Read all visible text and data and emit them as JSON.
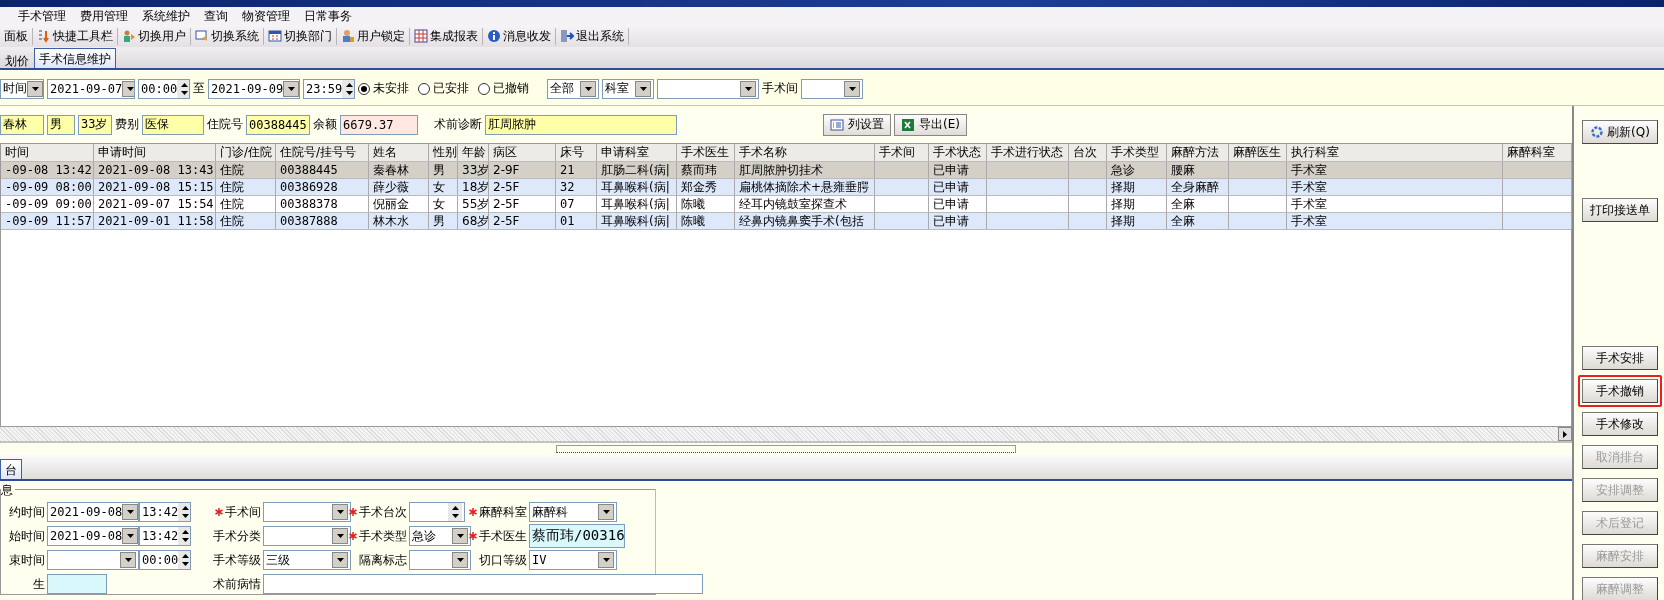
{
  "menu": [
    "手术管理",
    "费用管理",
    "系统维护",
    "查询",
    "物资管理",
    "日常事务"
  ],
  "toolbar": [
    {
      "label": "面板",
      "kind": "none"
    },
    {
      "label": "快捷工具栏",
      "kind": "list"
    },
    {
      "label": "切换用户",
      "kind": "users"
    },
    {
      "label": "切换系统",
      "kind": "window"
    },
    {
      "label": "切换部门",
      "kind": "calendar"
    },
    {
      "label": "用户锁定",
      "kind": "lock"
    },
    {
      "label": "集成报表",
      "kind": "grid"
    },
    {
      "label": "消息收发",
      "kind": "info"
    },
    {
      "label": "退出系统",
      "kind": "exit"
    }
  ],
  "tabs": [
    {
      "label": "划价",
      "selected": false
    },
    {
      "label": "手术信息维护",
      "selected": true
    }
  ],
  "filter": {
    "time_type": "时间",
    "start_date": "2021-09-07",
    "start_time": "00:00",
    "separator": "至",
    "end_date": "2021-09-09",
    "end_time": "23:59",
    "status_options": [
      {
        "label": "未安排",
        "selected": true
      },
      {
        "label": "已安排",
        "selected": false
      },
      {
        "label": "已撤销",
        "selected": false
      }
    ],
    "scope": "全部",
    "dept_type": "科室",
    "room_label": "手术间"
  },
  "patient": {
    "name": "春林",
    "sex": "男",
    "age": "33岁",
    "fee_label": "费别",
    "fee": "医保",
    "inpatient_no_label": "住院号",
    "inpatient_no": "00388445",
    "balance_label": "余额",
    "balance": "6679.37",
    "diagnosis_label": "术前诊断",
    "diagnosis": "肛周脓肿"
  },
  "table_buttons": [
    {
      "label": "列设置",
      "kind": "columns"
    },
    {
      "label": "导出(E)",
      "kind": "excel"
    }
  ],
  "table": {
    "columns": [
      "时间",
      "申请时间",
      "门诊/住院",
      "住院号/挂号号",
      "姓名",
      "性别",
      "年龄",
      "病区",
      "床号",
      "申请科室",
      "手术医生",
      "手术名称",
      "手术间",
      "手术状态",
      "手术进行状态",
      "台次",
      "手术类型",
      "麻醉方法",
      "麻醉医生",
      "执行科室",
      "麻醉科室"
    ],
    "rows": [
      {
        "selected": true,
        "cells": [
          "-09-08 13:42",
          "2021-09-08 13:43",
          "住院",
          "00388445",
          "秦春林",
          "男",
          "33岁",
          "2-9F",
          "21",
          "肛肠二科(病|",
          "蔡而玮",
          "肛周脓肿切挂术",
          null,
          "已申请",
          null,
          null,
          "急诊",
          "腰麻",
          null,
          "手术室",
          null
        ]
      },
      {
        "selected": false,
        "cells": [
          "-09-09 08:00",
          "2021-09-08 15:15",
          "住院",
          "00386928",
          "薛少薇",
          "女",
          "18岁",
          "2-5F",
          "32",
          "耳鼻喉科(病|",
          "郑金秀",
          "扁桃体摘除术+悬雍垂腭",
          null,
          "已申请",
          null,
          null,
          "择期",
          "全身麻醉",
          null,
          "手术室",
          null
        ]
      },
      {
        "selected": false,
        "cells": [
          "-09-09 09:00",
          "2021-09-07 15:54",
          "住院",
          "00388378",
          "倪丽金",
          "女",
          "55岁",
          "2-5F",
          "07",
          "耳鼻喉科(病|",
          "陈曦",
          "经耳内镜鼓室探查术",
          null,
          "已申请",
          null,
          null,
          "择期",
          "全麻",
          null,
          "手术室",
          null
        ]
      },
      {
        "selected": false,
        "cells": [
          "-09-09 11:57",
          "2021-09-01 11:58",
          "住院",
          "00387888",
          "林木水",
          "男",
          "68岁",
          "2-5F",
          "01",
          "耳鼻喉科(病|",
          "陈曦",
          "经鼻内镜鼻窦手术(包括",
          null,
          "已申请",
          null,
          null,
          "择期",
          "全麻",
          null,
          "手术室",
          null
        ]
      }
    ]
  },
  "side_buttons": [
    {
      "label": "刷新(Q)",
      "kind": "refresh",
      "disabled": false,
      "highlighted": false
    },
    {
      "label": "打印接送单",
      "kind": "plain",
      "disabled": false,
      "highlighted": false
    },
    {
      "label": "手术安排",
      "kind": "plain",
      "disabled": false,
      "highlighted": false
    },
    {
      "label": "手术撤销",
      "kind": "plain",
      "disabled": false,
      "highlighted": true
    },
    {
      "label": "手术修改",
      "kind": "plain",
      "disabled": false,
      "highlighted": false
    },
    {
      "label": "取消排台",
      "kind": "plain",
      "disabled": true,
      "highlighted": false
    },
    {
      "label": "安排调整",
      "kind": "plain",
      "disabled": true,
      "highlighted": false
    },
    {
      "label": "术后登记",
      "kind": "plain",
      "disabled": true,
      "highlighted": false
    },
    {
      "label": "麻醉安排",
      "kind": "plain",
      "disabled": true,
      "highlighted": false
    },
    {
      "label": "麻醉调整",
      "kind": "plain",
      "disabled": true,
      "highlighted": false
    }
  ],
  "bottom_tab": {
    "label": "台",
    "selected": true
  },
  "group_title": "息",
  "form": [
    [
      {
        "label": "约时间",
        "required": false,
        "controls": [
          {
            "kind": "date",
            "value": "2021-09-08"
          },
          {
            "kind": "time",
            "value": "13:42"
          }
        ]
      },
      {
        "label": "手术间",
        "required": true,
        "controls": [
          {
            "kind": "combo"
          }
        ]
      },
      {
        "label": "手术台次",
        "required": true,
        "controls": [
          {
            "kind": "spin"
          }
        ]
      },
      {
        "label": "麻醉科室",
        "required": true,
        "controls": [
          {
            "kind": "combo",
            "value": "麻醉科"
          }
        ]
      }
    ],
    [
      {
        "label": "始时间",
        "required": false,
        "controls": [
          {
            "kind": "date",
            "value": "2021-09-08"
          },
          {
            "kind": "time",
            "value": "13:42"
          }
        ]
      },
      {
        "label": "手术分类",
        "required": false,
        "controls": [
          {
            "kind": "combo"
          }
        ]
      },
      {
        "label": "手术类型",
        "required": true,
        "controls": [
          {
            "kind": "shortcombo",
            "value": "急诊"
          }
        ]
      },
      {
        "label": "手术医生",
        "required": true,
        "controls": [
          {
            "kind": "text",
            "value": "蔡而玮/00316"
          }
        ]
      }
    ],
    [
      {
        "label": "束时间",
        "required": false,
        "controls": [
          {
            "kind": "date"
          },
          {
            "kind": "time",
            "value": "00:00"
          }
        ]
      },
      {
        "label": "手术等级",
        "required": false,
        "controls": [
          {
            "kind": "combo",
            "value": "三级"
          }
        ]
      },
      {
        "label": "隔离标志",
        "required": false,
        "controls": [
          {
            "kind": "shortcombo"
          }
        ]
      },
      {
        "label": "切口等级",
        "required": false,
        "controls": [
          {
            "kind": "combo",
            "value": "IV"
          }
        ]
      }
    ],
    [
      {
        "label": "生",
        "required": false,
        "controls": [
          {
            "kind": "text"
          }
        ]
      },
      {
        "label": "术前病情",
        "required": false,
        "controls": [
          {
            "kind": "wide"
          }
        ]
      }
    ]
  ]
}
